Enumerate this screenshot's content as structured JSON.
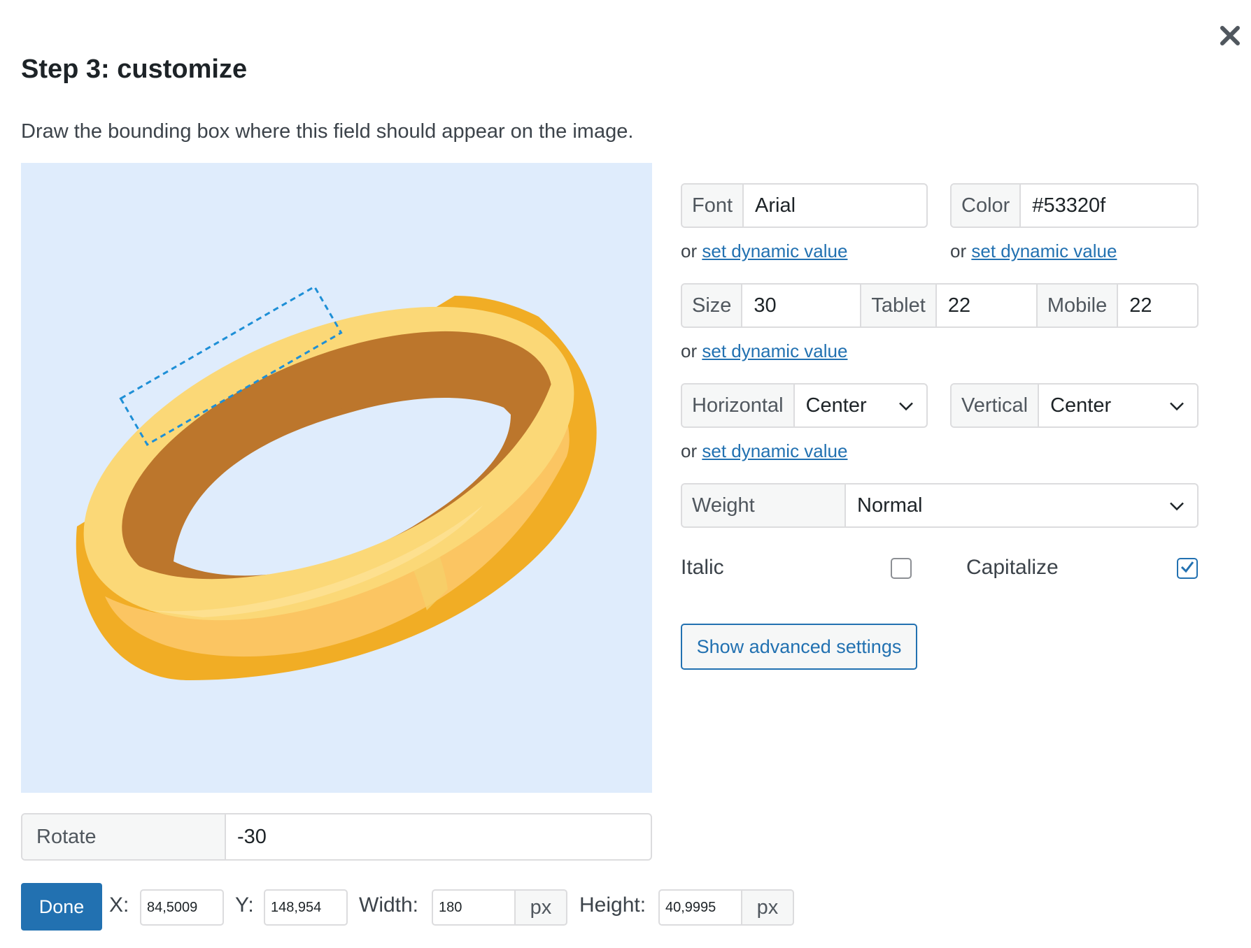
{
  "dialog": {
    "title": "Step 3: customize",
    "instruction": "Draw the bounding box where this field should appear on the image.",
    "close_icon": "close-icon"
  },
  "fields": {
    "font": {
      "label": "Font",
      "value": "Arial"
    },
    "color": {
      "label": "Color",
      "value": "#53320f"
    },
    "size": {
      "label": "Size",
      "value": "30"
    },
    "tablet": {
      "label": "Tablet",
      "value": "22"
    },
    "mobile": {
      "label": "Mobile",
      "value": "22"
    },
    "horizontal": {
      "label": "Horizontal",
      "value": "Center"
    },
    "vertical": {
      "label": "Vertical",
      "value": "Center"
    },
    "weight": {
      "label": "Weight",
      "value": "Normal"
    },
    "italic": {
      "label": "Italic",
      "checked": false
    },
    "capitalize": {
      "label": "Capitalize",
      "checked": true
    }
  },
  "dynamic": {
    "prefix": "or",
    "link": "set dynamic value"
  },
  "advanced_button": "Show advanced settings",
  "rotate": {
    "label": "Rotate",
    "value": "-30"
  },
  "bottom_bar": {
    "done": "Done",
    "x_label": "X:",
    "x_value": "84,5009",
    "y_label": "Y:",
    "y_value": "148,954",
    "width_label": "Width:",
    "width_value": "180",
    "height_label": "Height:",
    "height_value": "40,9995",
    "unit": "px"
  },
  "colors": {
    "accent": "#2271b1",
    "canvas_bg": "#dfecfc",
    "ring_gold": "#f1ad25",
    "ring_inner": "#bc762c",
    "ring_top": "#fbd877",
    "bounding_box": "#1e8fd6"
  }
}
